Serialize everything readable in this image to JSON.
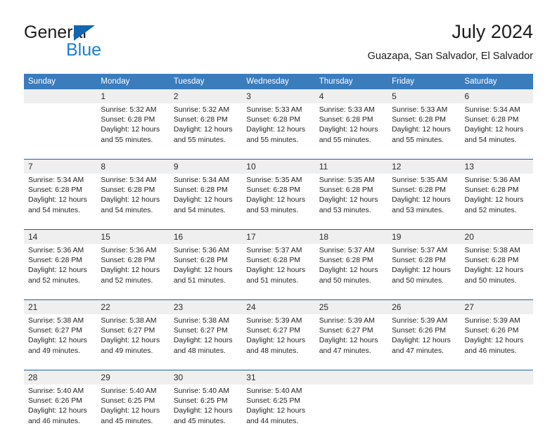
{
  "brand": {
    "line1": "General",
    "line2": "Blue",
    "triangle_color": "#1565ad",
    "blue_color": "#1b7fd4"
  },
  "header": {
    "title": "July 2024",
    "subtitle": "Guazapa, San Salvador, El Salvador"
  },
  "theme": {
    "header_blue": "#3b7cbd",
    "separator_blue": "#1f5fa0",
    "daynum_band": "#efefef",
    "text": "#232323"
  },
  "calendar": {
    "weekday_headers": [
      "Sunday",
      "Monday",
      "Tuesday",
      "Wednesday",
      "Thursday",
      "Friday",
      "Saturday"
    ],
    "weeks": [
      [
        {
          "day": "",
          "sunrise": "",
          "sunset": "",
          "daylight1": "",
          "daylight2": ""
        },
        {
          "day": "1",
          "sunrise": "Sunrise: 5:32 AM",
          "sunset": "Sunset: 6:28 PM",
          "daylight1": "Daylight: 12 hours",
          "daylight2": "and 55 minutes."
        },
        {
          "day": "2",
          "sunrise": "Sunrise: 5:32 AM",
          "sunset": "Sunset: 6:28 PM",
          "daylight1": "Daylight: 12 hours",
          "daylight2": "and 55 minutes."
        },
        {
          "day": "3",
          "sunrise": "Sunrise: 5:33 AM",
          "sunset": "Sunset: 6:28 PM",
          "daylight1": "Daylight: 12 hours",
          "daylight2": "and 55 minutes."
        },
        {
          "day": "4",
          "sunrise": "Sunrise: 5:33 AM",
          "sunset": "Sunset: 6:28 PM",
          "daylight1": "Daylight: 12 hours",
          "daylight2": "and 55 minutes."
        },
        {
          "day": "5",
          "sunrise": "Sunrise: 5:33 AM",
          "sunset": "Sunset: 6:28 PM",
          "daylight1": "Daylight: 12 hours",
          "daylight2": "and 55 minutes."
        },
        {
          "day": "6",
          "sunrise": "Sunrise: 5:34 AM",
          "sunset": "Sunset: 6:28 PM",
          "daylight1": "Daylight: 12 hours",
          "daylight2": "and 54 minutes."
        }
      ],
      [
        {
          "day": "7",
          "sunrise": "Sunrise: 5:34 AM",
          "sunset": "Sunset: 6:28 PM",
          "daylight1": "Daylight: 12 hours",
          "daylight2": "and 54 minutes."
        },
        {
          "day": "8",
          "sunrise": "Sunrise: 5:34 AM",
          "sunset": "Sunset: 6:28 PM",
          "daylight1": "Daylight: 12 hours",
          "daylight2": "and 54 minutes."
        },
        {
          "day": "9",
          "sunrise": "Sunrise: 5:34 AM",
          "sunset": "Sunset: 6:28 PM",
          "daylight1": "Daylight: 12 hours",
          "daylight2": "and 54 minutes."
        },
        {
          "day": "10",
          "sunrise": "Sunrise: 5:35 AM",
          "sunset": "Sunset: 6:28 PM",
          "daylight1": "Daylight: 12 hours",
          "daylight2": "and 53 minutes."
        },
        {
          "day": "11",
          "sunrise": "Sunrise: 5:35 AM",
          "sunset": "Sunset: 6:28 PM",
          "daylight1": "Daylight: 12 hours",
          "daylight2": "and 53 minutes."
        },
        {
          "day": "12",
          "sunrise": "Sunrise: 5:35 AM",
          "sunset": "Sunset: 6:28 PM",
          "daylight1": "Daylight: 12 hours",
          "daylight2": "and 53 minutes."
        },
        {
          "day": "13",
          "sunrise": "Sunrise: 5:36 AM",
          "sunset": "Sunset: 6:28 PM",
          "daylight1": "Daylight: 12 hours",
          "daylight2": "and 52 minutes."
        }
      ],
      [
        {
          "day": "14",
          "sunrise": "Sunrise: 5:36 AM",
          "sunset": "Sunset: 6:28 PM",
          "daylight1": "Daylight: 12 hours",
          "daylight2": "and 52 minutes."
        },
        {
          "day": "15",
          "sunrise": "Sunrise: 5:36 AM",
          "sunset": "Sunset: 6:28 PM",
          "daylight1": "Daylight: 12 hours",
          "daylight2": "and 52 minutes."
        },
        {
          "day": "16",
          "sunrise": "Sunrise: 5:36 AM",
          "sunset": "Sunset: 6:28 PM",
          "daylight1": "Daylight: 12 hours",
          "daylight2": "and 51 minutes."
        },
        {
          "day": "17",
          "sunrise": "Sunrise: 5:37 AM",
          "sunset": "Sunset: 6:28 PM",
          "daylight1": "Daylight: 12 hours",
          "daylight2": "and 51 minutes."
        },
        {
          "day": "18",
          "sunrise": "Sunrise: 5:37 AM",
          "sunset": "Sunset: 6:28 PM",
          "daylight1": "Daylight: 12 hours",
          "daylight2": "and 50 minutes."
        },
        {
          "day": "19",
          "sunrise": "Sunrise: 5:37 AM",
          "sunset": "Sunset: 6:28 PM",
          "daylight1": "Daylight: 12 hours",
          "daylight2": "and 50 minutes."
        },
        {
          "day": "20",
          "sunrise": "Sunrise: 5:38 AM",
          "sunset": "Sunset: 6:28 PM",
          "daylight1": "Daylight: 12 hours",
          "daylight2": "and 50 minutes."
        }
      ],
      [
        {
          "day": "21",
          "sunrise": "Sunrise: 5:38 AM",
          "sunset": "Sunset: 6:27 PM",
          "daylight1": "Daylight: 12 hours",
          "daylight2": "and 49 minutes."
        },
        {
          "day": "22",
          "sunrise": "Sunrise: 5:38 AM",
          "sunset": "Sunset: 6:27 PM",
          "daylight1": "Daylight: 12 hours",
          "daylight2": "and 49 minutes."
        },
        {
          "day": "23",
          "sunrise": "Sunrise: 5:38 AM",
          "sunset": "Sunset: 6:27 PM",
          "daylight1": "Daylight: 12 hours",
          "daylight2": "and 48 minutes."
        },
        {
          "day": "24",
          "sunrise": "Sunrise: 5:39 AM",
          "sunset": "Sunset: 6:27 PM",
          "daylight1": "Daylight: 12 hours",
          "daylight2": "and 48 minutes."
        },
        {
          "day": "25",
          "sunrise": "Sunrise: 5:39 AM",
          "sunset": "Sunset: 6:27 PM",
          "daylight1": "Daylight: 12 hours",
          "daylight2": "and 47 minutes."
        },
        {
          "day": "26",
          "sunrise": "Sunrise: 5:39 AM",
          "sunset": "Sunset: 6:26 PM",
          "daylight1": "Daylight: 12 hours",
          "daylight2": "and 47 minutes."
        },
        {
          "day": "27",
          "sunrise": "Sunrise: 5:39 AM",
          "sunset": "Sunset: 6:26 PM",
          "daylight1": "Daylight: 12 hours",
          "daylight2": "and 46 minutes."
        }
      ],
      [
        {
          "day": "28",
          "sunrise": "Sunrise: 5:40 AM",
          "sunset": "Sunset: 6:26 PM",
          "daylight1": "Daylight: 12 hours",
          "daylight2": "and 46 minutes."
        },
        {
          "day": "29",
          "sunrise": "Sunrise: 5:40 AM",
          "sunset": "Sunset: 6:25 PM",
          "daylight1": "Daylight: 12 hours",
          "daylight2": "and 45 minutes."
        },
        {
          "day": "30",
          "sunrise": "Sunrise: 5:40 AM",
          "sunset": "Sunset: 6:25 PM",
          "daylight1": "Daylight: 12 hours",
          "daylight2": "and 45 minutes."
        },
        {
          "day": "31",
          "sunrise": "Sunrise: 5:40 AM",
          "sunset": "Sunset: 6:25 PM",
          "daylight1": "Daylight: 12 hours",
          "daylight2": "and 44 minutes."
        },
        {
          "day": "",
          "sunrise": "",
          "sunset": "",
          "daylight1": "",
          "daylight2": ""
        },
        {
          "day": "",
          "sunrise": "",
          "sunset": "",
          "daylight1": "",
          "daylight2": ""
        },
        {
          "day": "",
          "sunrise": "",
          "sunset": "",
          "daylight1": "",
          "daylight2": ""
        }
      ]
    ]
  }
}
